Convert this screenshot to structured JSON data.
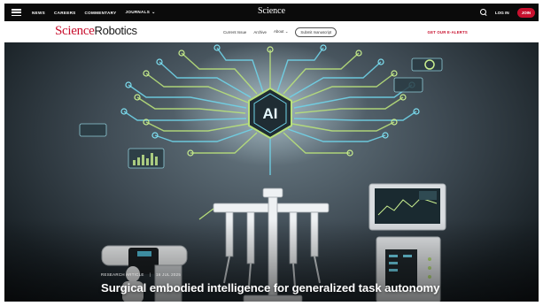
{
  "topbar": {
    "nav": [
      "NEWS",
      "CAREERS",
      "COMMENTARY",
      "JOURNALS"
    ],
    "journals_chevron": "⌄",
    "logo": "Science",
    "login": "LOG IN",
    "join": "JOIN"
  },
  "subheader": {
    "brand_part1": "Science",
    "brand_part2": "Robotics",
    "nav": [
      "Current Issue",
      "Archive",
      "About"
    ],
    "about_chevron": "⌄",
    "submit": "Submit manuscript",
    "alerts": "GET OUR E-ALERTS"
  },
  "hero": {
    "ai_label": "AI",
    "kicker": "RESEARCH ARTICLE",
    "date": "16 JUL 2025",
    "headline": "Surgical embodied intelligence for generalized task autonomy"
  },
  "colors": {
    "brand_red": "#c8102e",
    "circuit_green": "#b8e07a",
    "circuit_cyan": "#6fd3e8",
    "dark_bar": "#0b0b0b"
  }
}
